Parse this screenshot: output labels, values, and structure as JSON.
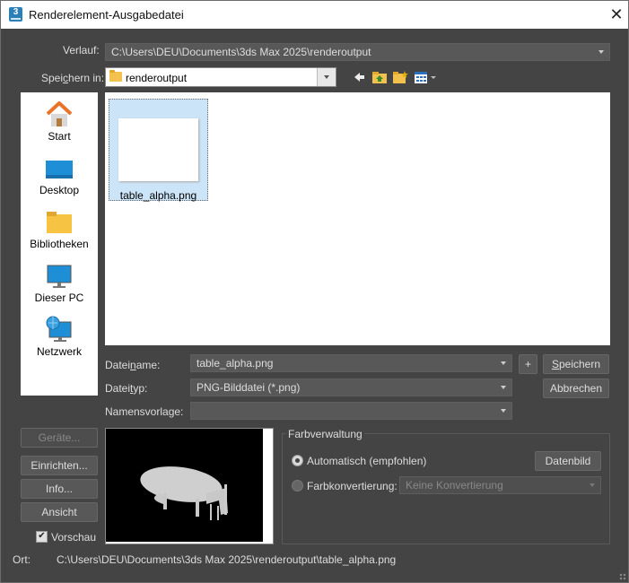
{
  "window": {
    "title": "Renderelement-Ausgabedatei",
    "app_icon_text": "3"
  },
  "history": {
    "label": "Verlauf:",
    "value": "C:\\Users\\DEU\\Documents\\3ds Max 2025\\renderoutput"
  },
  "save_in": {
    "label_pre": "Spei",
    "label_u": "c",
    "label_post": "hern in:",
    "value": "renderoutput"
  },
  "places": [
    {
      "label": "Start",
      "icon": "home-icon"
    },
    {
      "label": "Desktop",
      "icon": "desktop-icon"
    },
    {
      "label": "Bibliotheken",
      "icon": "libraries-icon"
    },
    {
      "label": "Dieser PC",
      "icon": "computer-icon"
    },
    {
      "label": "Netzwerk",
      "icon": "network-icon"
    }
  ],
  "files": [
    {
      "name": "table_alpha.png"
    }
  ],
  "filename": {
    "label_pre": "Datei",
    "label_u": "n",
    "label_post": "ame:",
    "value": "table_alpha.png"
  },
  "filetype": {
    "label_pre": "Datei",
    "label_u": "t",
    "label_post": "yp:",
    "value": "PNG-Bilddatei (*.png)"
  },
  "template": {
    "label": "Namensvorlage:",
    "value": ""
  },
  "buttons": {
    "plus": "+",
    "save_u": "S",
    "save_rest": "peichern",
    "cancel": "Abbrechen",
    "devices": "Geräte...",
    "setup": "Einrichten...",
    "info": "Info...",
    "view": "Ansicht",
    "datenbild": "Datenbild"
  },
  "preview_toggle": {
    "label": "Vorschau",
    "checked": true
  },
  "color_mgmt": {
    "title": "Farbverwaltung",
    "auto_label": "Automatisch (empfohlen)",
    "conv_label": "Farbkonvertierung:",
    "conv_value": "Keine Konvertierung"
  },
  "location": {
    "label": "Ort:",
    "value": "C:\\Users\\DEU\\Documents\\3ds Max 2025\\renderoutput\\table_alpha.png"
  }
}
